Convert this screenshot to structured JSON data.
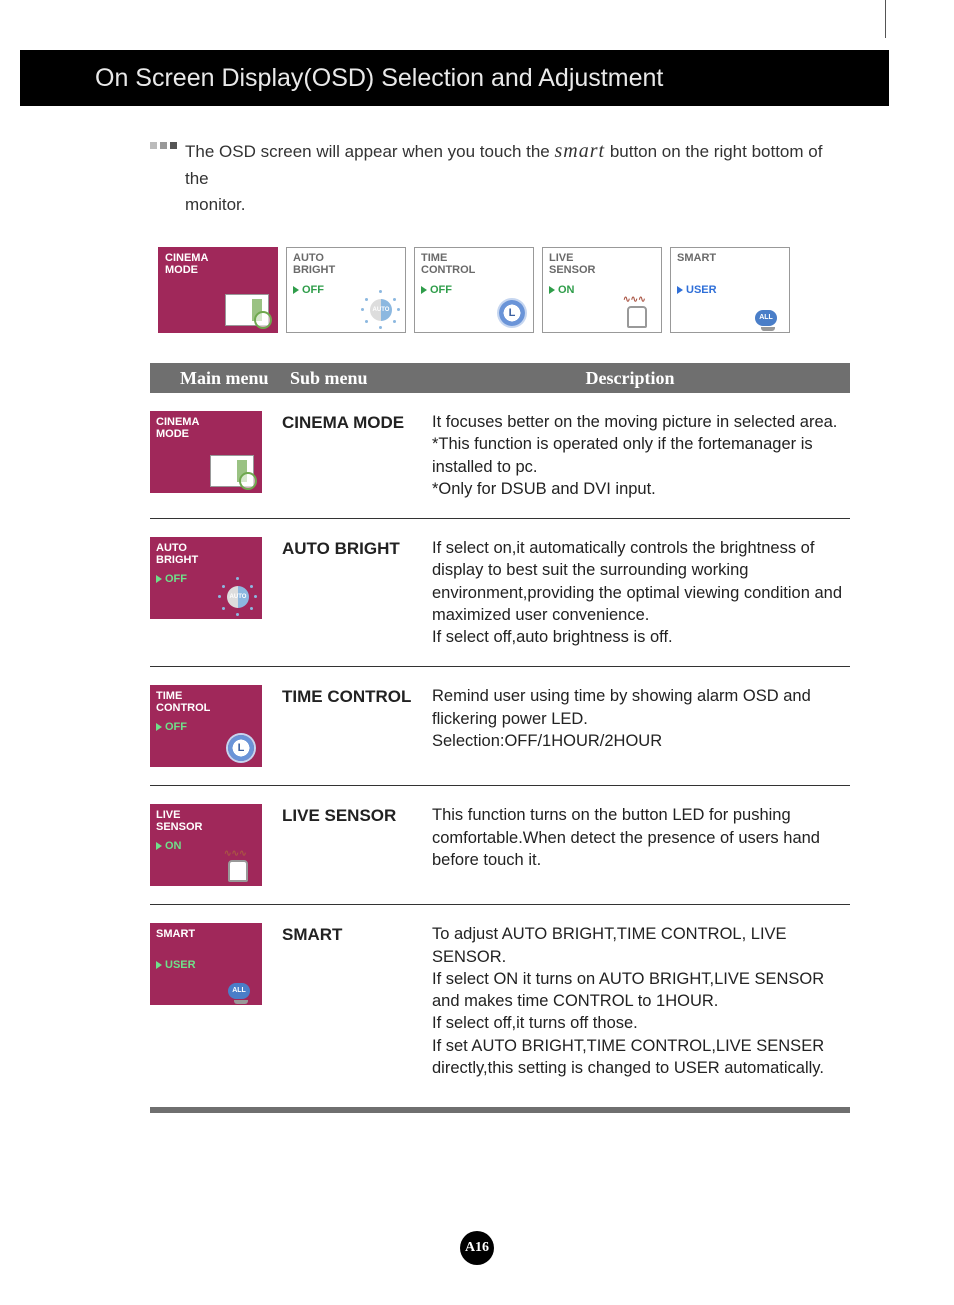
{
  "header": "On Screen Display(OSD) Selection and Adjustment",
  "intro": {
    "part1": "The OSD screen will appear when you touch the",
    "smart_word": "smart",
    "part2": "button on the right bottom of the",
    "line2": "monitor."
  },
  "tiles": [
    {
      "line1": "CINEMA",
      "line2": "MODE",
      "status": "",
      "type": "cinema",
      "active": true
    },
    {
      "line1": "AUTO",
      "line2": "BRIGHT",
      "status": "OFF",
      "type": "auto",
      "active": false
    },
    {
      "line1": "TIME",
      "line2": "CONTROL",
      "status": "OFF",
      "type": "time",
      "active": false
    },
    {
      "line1": "LIVE",
      "line2": "SENSOR",
      "status": "ON",
      "type": "live",
      "active": false
    },
    {
      "line1": "SMART",
      "line2": "",
      "status": "USER",
      "status_blue": true,
      "type": "smart",
      "active": false
    }
  ],
  "table_header": {
    "col1": "Main menu",
    "col2": "Sub menu",
    "col3": "Description"
  },
  "rows": [
    {
      "thumb": {
        "line1": "CINEMA",
        "line2": "MODE",
        "status": "",
        "type": "cinema"
      },
      "label": "CINEMA MODE",
      "desc": "It focuses better on the moving picture in selected area.\n*This function is operated only if the fortemanager is installed to pc.\n*Only for DSUB and DVI input."
    },
    {
      "thumb": {
        "line1": "AUTO",
        "line2": "BRIGHT",
        "status": "OFF",
        "type": "auto"
      },
      "label": "AUTO BRIGHT",
      "desc": "If select on,it automatically controls the brightness of display to best suit the surrounding working environment,providing the optimal viewing condition and maximized user convenience.\nIf select off,auto brightness is off."
    },
    {
      "thumb": {
        "line1": "TIME",
        "line2": "CONTROL",
        "status": "OFF",
        "type": "time"
      },
      "label": "TIME CONTROL",
      "desc": "Remind user using time by showing alarm OSD and flickering power LED.\nSelection:OFF/1HOUR/2HOUR"
    },
    {
      "thumb": {
        "line1": "LIVE",
        "line2": "SENSOR",
        "status": "ON",
        "type": "live"
      },
      "label": "LIVE SENSOR",
      "desc": "This function turns on the button LED for pushing comfortable.When detect the presence of users hand before touch it."
    },
    {
      "thumb": {
        "line1": "SMART",
        "line2": "",
        "status": "USER",
        "type": "smart"
      },
      "label": "SMART",
      "desc": "To adjust AUTO BRIGHT,TIME CONTROL, LIVE SENSOR.\nIf select ON it turns on AUTO BRIGHT,LIVE SENSOR and makes time CONTROL to 1HOUR.\nIf select off,it turns off those.\nIf set AUTO BRIGHT,TIME CONTROL,LIVE SENSER directly,this setting is changed to USER automatically."
    }
  ],
  "page_number": "A16"
}
